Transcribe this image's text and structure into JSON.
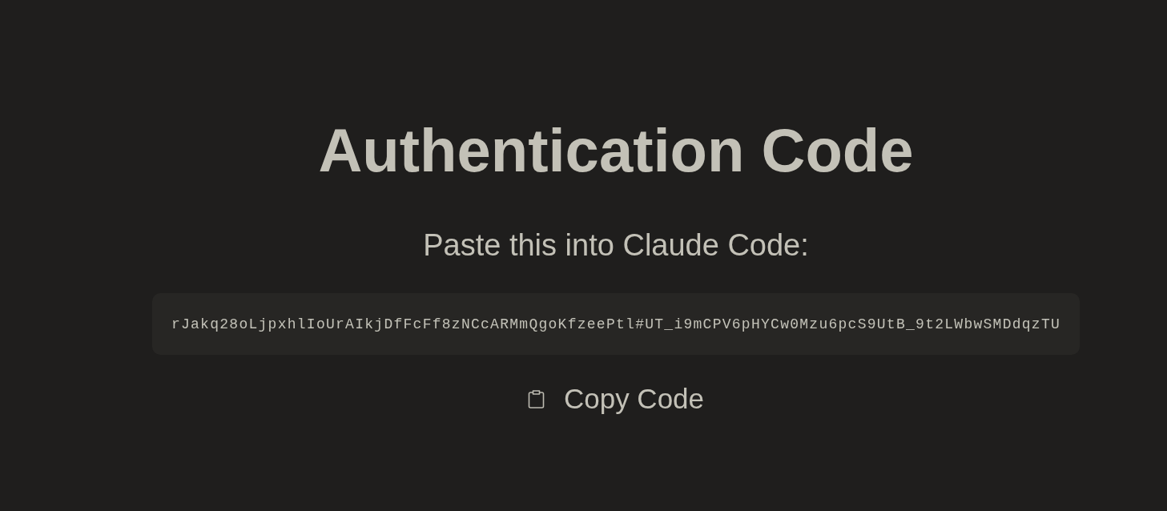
{
  "title": "Authentication Code",
  "instruction": "Paste this into Claude Code:",
  "code": "rJakq28oLjpxhlIoUrAIkjDfFcFf8zNCcARMmQgoKfzeePtl#UT_i9mCPV6pHYCw0Mzu6pcS9UtB_9t2LWbwSMDdqzTU",
  "copy_button": {
    "label": "Copy Code"
  }
}
